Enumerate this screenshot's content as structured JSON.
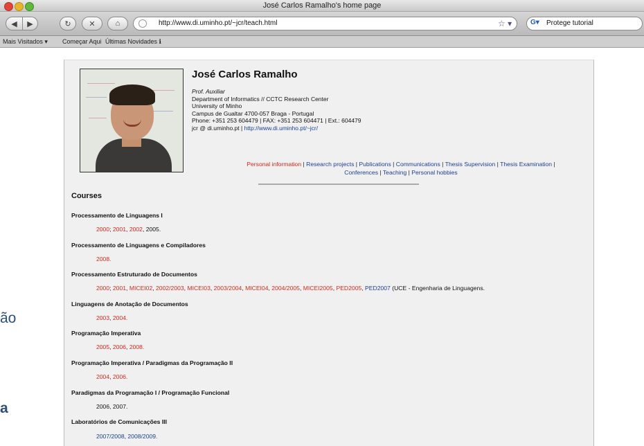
{
  "window": {
    "title": "José Carlos Ramalho's home page"
  },
  "toolbar": {
    "url": "http://www.di.uminho.pt/~jcr/teach.html",
    "search_text": "Protege tutorial"
  },
  "bookmarks": [
    "Mais Visitados ▾",
    "Começar Aqui",
    "Últimas Novidades ℹ"
  ],
  "background": {
    "fragment_1": "ão",
    "fragment_2": "a"
  },
  "profile": {
    "name": "José Carlos Ramalho",
    "title": "Prof. Auxiliar",
    "department": "Department of Informatics // CCTC Research Center",
    "university": "University of Minho",
    "address": "Campus de Gualtar 4700-057 Braga - Portugal",
    "phone": "Phone: +351 253 604479 | FAX: +351 253 604471 | Ext.: 604479",
    "email": "jcr @ di.uminho.pt",
    "homepage": "http://www.di.uminho.pt/~jcr/"
  },
  "nav": {
    "items": [
      "Personal information",
      "Research projects",
      "Publications",
      "Communications",
      "Thesis Supervision",
      "Thesis Examination",
      "Conferences",
      "Teaching",
      "Personal hobbies"
    ]
  },
  "courses": {
    "heading": "Courses",
    "list": [
      {
        "name": "Processamento de Linguagens I",
        "years": [
          "2000",
          "2001",
          "2002",
          "2005."
        ]
      },
      {
        "name": "Processamento de Linguagens e Compiladores",
        "years": [
          "2008."
        ]
      },
      {
        "name": "Processamento Estruturado de Documentos",
        "years": [
          "2000",
          "2001",
          "MICEI02",
          "2002/2003",
          "MICEI03",
          "2003/2004",
          "MICEI04",
          "2004/2005",
          "MICEI2005",
          "PED2005",
          "PED2007"
        ],
        "suffix": "(UCE - Engenharia de Linguagens."
      },
      {
        "name": "Linguagens de Anotação de Documentos",
        "years": [
          "2003",
          "2004."
        ]
      },
      {
        "name": "Programação Imperativa",
        "years": [
          "2005",
          "2006",
          "2008."
        ]
      },
      {
        "name": "Programação Imperativa / Paradigmas da Programação II",
        "years": [
          "2004",
          "2006."
        ]
      },
      {
        "name": "Paradigmas da Programação I / Programação Funcional",
        "years": [
          "2006, 2007."
        ]
      },
      {
        "name": "Laboratórios de Comunicações III",
        "years": [
          "2007/2008",
          "2008/2009."
        ]
      }
    ]
  }
}
